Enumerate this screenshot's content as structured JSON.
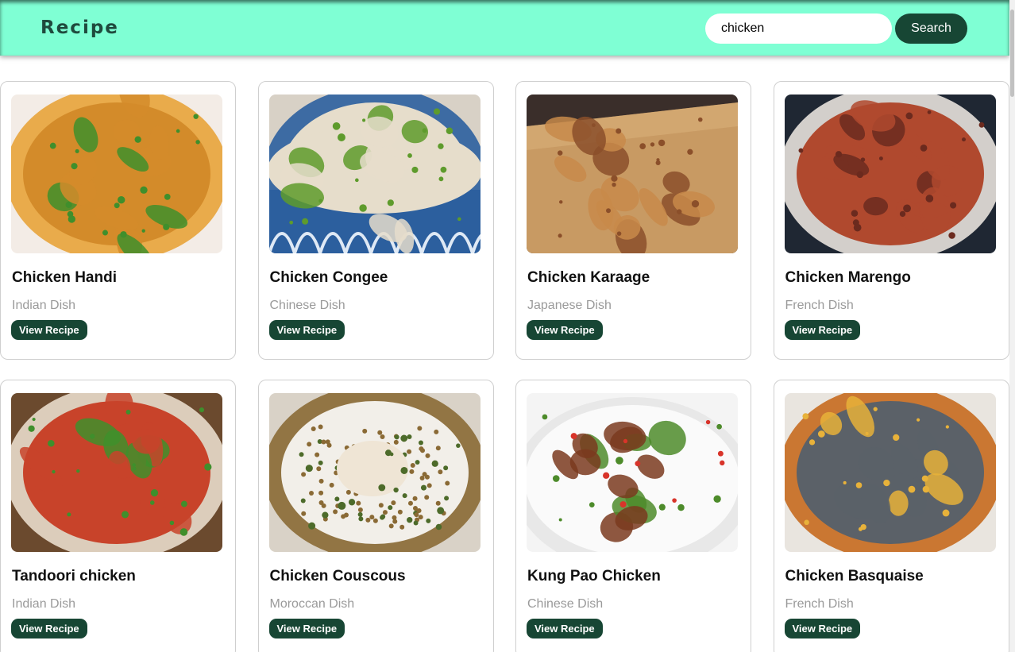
{
  "header": {
    "brand": "Recipe",
    "search_value": "chicken",
    "search_button": "Search"
  },
  "recipes": [
    {
      "title": "Chicken Handi",
      "cuisine": "Indian Dish",
      "button": "View Recipe",
      "image_icon": "curry-bowl-image",
      "colors": [
        "#f3ece6",
        "#d38b2a",
        "#e8a43a",
        "#3f8f2c"
      ]
    },
    {
      "title": "Chicken Congee",
      "cuisine": "Chinese Dish",
      "button": "View Recipe",
      "image_icon": "congee-bowl-image",
      "colors": [
        "#d8d1c6",
        "#e6ddcb",
        "#2c5f9e",
        "#5e9b2c"
      ]
    },
    {
      "title": "Chicken Karaage",
      "cuisine": "Japanese Dish",
      "button": "View Recipe",
      "image_icon": "fried-chicken-board-image",
      "colors": [
        "#3a2e2a",
        "#c88a4a",
        "#7ac043",
        "#8b4f2a"
      ]
    },
    {
      "title": "Chicken Marengo",
      "cuisine": "French Dish",
      "button": "View Recipe",
      "image_icon": "stew-pot-image",
      "colors": [
        "#1f2733",
        "#b0492e",
        "#e7e2dc",
        "#6b2a1e"
      ]
    },
    {
      "title": "Tandoori chicken",
      "cuisine": "Indian Dish",
      "button": "View Recipe",
      "image_icon": "tandoori-platter-image",
      "colors": [
        "#6b4a2e",
        "#c8432a",
        "#e9dccb",
        "#3f8f2c"
      ]
    },
    {
      "title": "Chicken Couscous",
      "cuisine": "Moroccan Dish",
      "button": "View Recipe",
      "image_icon": "couscous-plate-image",
      "colors": [
        "#d9d2c7",
        "#f2efe9",
        "#8a6a35",
        "#4d6b2a"
      ]
    },
    {
      "title": "Kung Pao Chicken",
      "cuisine": "Chinese Dish",
      "button": "View Recipe",
      "image_icon": "stir-fry-bowl-image",
      "colors": [
        "#f4f4f4",
        "#7a3a1e",
        "#d8342a",
        "#4d8b2a"
      ]
    },
    {
      "title": "Chicken Basquaise",
      "cuisine": "French Dish",
      "button": "View Recipe",
      "image_icon": "braiser-pan-image",
      "colors": [
        "#e9e5df",
        "#5b6168",
        "#c76a1f",
        "#e8b23a"
      ]
    }
  ]
}
